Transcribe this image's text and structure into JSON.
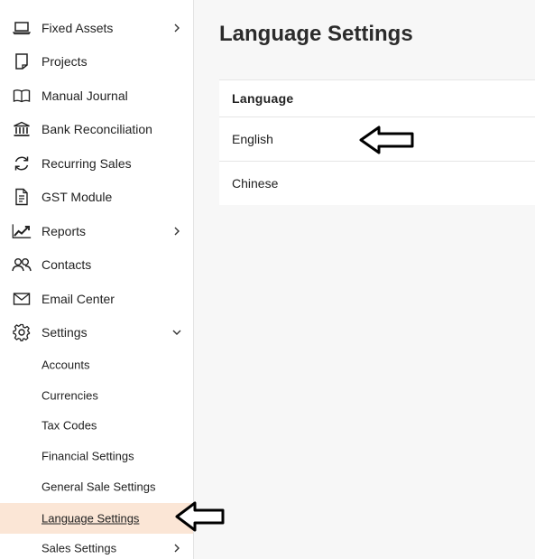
{
  "sidebar": {
    "items": [
      {
        "label": "Fixed Assets",
        "icon": "laptop-icon",
        "has_chevron": "right"
      },
      {
        "label": "Projects",
        "icon": "document-icon"
      },
      {
        "label": "Manual Journal",
        "icon": "book-icon"
      },
      {
        "label": "Bank Reconciliation",
        "icon": "bank-icon"
      },
      {
        "label": "Recurring Sales",
        "icon": "refresh-icon"
      },
      {
        "label": "GST Module",
        "icon": "file-text-icon"
      },
      {
        "label": "Reports",
        "icon": "trend-chart-icon",
        "has_chevron": "right"
      },
      {
        "label": "Contacts",
        "icon": "users-icon"
      },
      {
        "label": "Email Center",
        "icon": "mail-icon"
      },
      {
        "label": "Settings",
        "icon": "gear-icon",
        "has_chevron": "down"
      }
    ],
    "settings_sub": [
      {
        "label": "Accounts"
      },
      {
        "label": "Currencies"
      },
      {
        "label": "Tax Codes"
      },
      {
        "label": "Financial Settings"
      },
      {
        "label": "General Sale Settings"
      },
      {
        "label": "Language Settings",
        "active": true
      },
      {
        "label": "Sales Settings",
        "has_chevron": "right"
      }
    ]
  },
  "main": {
    "title": "Language Settings",
    "table": {
      "header": "Language",
      "rows": [
        "English",
        "Chinese"
      ]
    }
  },
  "colors": {
    "active_bg": "#fbe6d6",
    "page_bg": "#f7f7f7"
  }
}
